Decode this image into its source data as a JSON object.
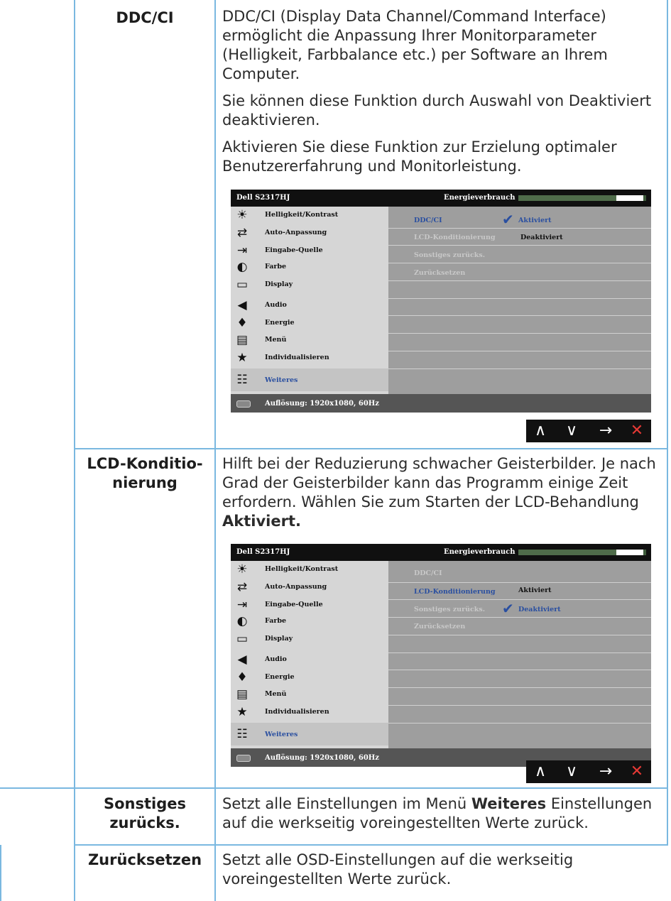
{
  "rows": {
    "ddcci": {
      "term": "DDC/CI",
      "p1": "DDC/CI (Display Data Channel/Command Interface) ermöglicht die Anpassung Ihrer Monitorparameter (Helligkeit, Farbbalance etc.) per Software an Ihrem Computer.",
      "p2": "Sie können diese Funktion durch Auswahl von Deaktiviert deaktivieren.",
      "p3": "Aktivieren Sie diese Funktion zur Erzielung optimaler Benutzererfahrung und Monitorleistung."
    },
    "lcd": {
      "term": "LCD-Konditio-nierung",
      "p1": "Hilft bei der Reduzierung schwacher Geisterbilder. Je nach Grad der Geisterbilder kann das Programm einige Zeit erfordern. Wählen Sie zum Starten der LCD-Behandlung ",
      "p1_bold": "Aktiviert."
    },
    "sonstiges": {
      "term": "Sonstiges zurücks.",
      "p1_a": "Setzt alle Einstellungen im Menü ",
      "p1_bold": "Weiteres",
      "p1_b": " Einstellungen auf die werkseitig voreingestellten Werte zurück."
    },
    "zuruck": {
      "term": "Zurücksetzen",
      "p1": "Setzt alle OSD-Einstellungen auf die werkseitig voreingestellten Werte zurück."
    }
  },
  "osd": {
    "model": "Dell S2317HJ",
    "energy_label": "Energieverbrauch",
    "energy_level": 0.78,
    "menu": [
      {
        "icon": "brightness-icon",
        "glyph": "☀",
        "label": "Helligkeit/Kontrast"
      },
      {
        "icon": "auto-adjust-icon",
        "glyph": "⇄",
        "label": "Auto-Anpassung"
      },
      {
        "icon": "input-source-icon",
        "glyph": "⇥",
        "label": "Eingabe-Quelle"
      },
      {
        "icon": "color-icon",
        "glyph": "◐",
        "label": "Farbe"
      },
      {
        "icon": "display-icon",
        "glyph": "▭",
        "label": "Display"
      },
      {
        "icon": "audio-icon",
        "glyph": "◀",
        "label": "Audio"
      },
      {
        "icon": "energy-icon",
        "glyph": "♦",
        "label": "Energie"
      },
      {
        "icon": "menu-icon",
        "glyph": "▤",
        "label": "Menü"
      },
      {
        "icon": "star-icon",
        "glyph": "★",
        "label": "Individualisieren"
      },
      {
        "icon": "other-icon",
        "glyph": "☷",
        "label": "Weiteres"
      }
    ],
    "submenu": [
      "DDC/CI",
      "LCD-Konditionierung",
      "Sonstiges zurücks.",
      "Zurücksetzen"
    ],
    "opt_on": "Aktiviert",
    "opt_off": "Deaktiviert",
    "resolution": "Auflösung: 1920x1080, 60Hz"
  },
  "nav": {
    "up": "∧",
    "down": "∨",
    "right": "→",
    "close": "✕"
  },
  "colors": {
    "rule": "#7ab8e0",
    "accent": "#2a4fa0",
    "close": "#e53935"
  }
}
